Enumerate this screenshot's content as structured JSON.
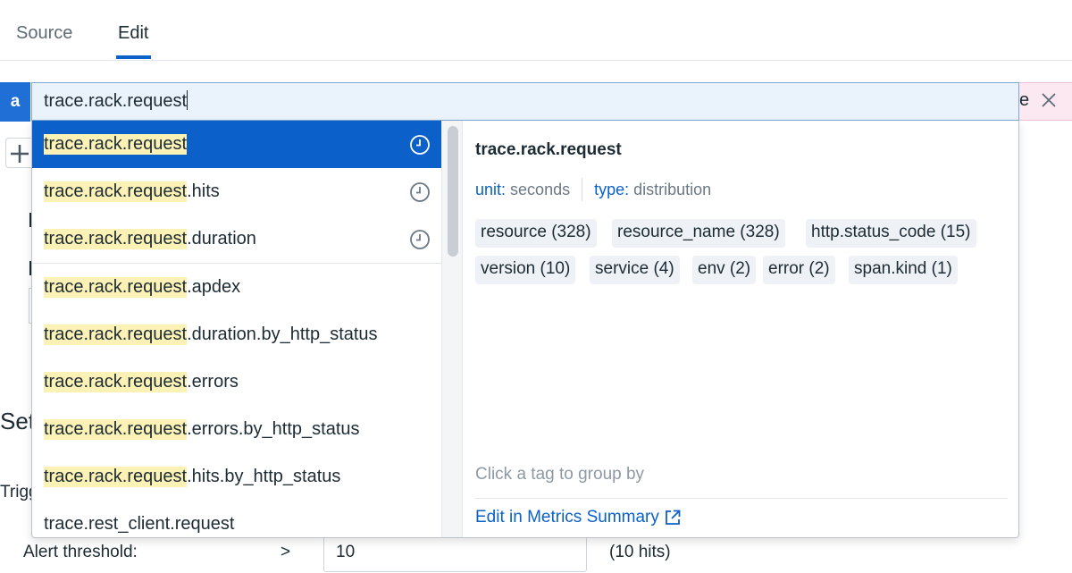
{
  "tabs": [
    {
      "label": "Source"
    },
    {
      "label": "Edit"
    }
  ],
  "query": {
    "letter": "a",
    "value": "trace.rack.request",
    "trailing_text": "e"
  },
  "suggestions": {
    "match": "trace.rack.request",
    "items": [
      {
        "match": "trace.rack.request",
        "suffix": "",
        "recent": true,
        "selected": true
      },
      {
        "match": "trace.rack.request",
        "suffix": ".hits",
        "recent": true
      },
      {
        "match": "trace.rack.request",
        "suffix": ".duration",
        "recent": true
      },
      {
        "match": "trace.rack.request",
        "suffix": ".apdex",
        "recent": false
      },
      {
        "match": "trace.rack.request",
        "suffix": ".duration.by_http_status",
        "recent": false
      },
      {
        "match": "trace.rack.request",
        "suffix": ".errors",
        "recent": false
      },
      {
        "match": "trace.rack.request",
        "suffix": ".errors.by_http_status",
        "recent": false
      },
      {
        "match": "trace.rack.request",
        "suffix": ".hits.by_http_status",
        "recent": false
      },
      {
        "match": "",
        "suffix": "trace.rest_client.request",
        "recent": false
      }
    ]
  },
  "detail": {
    "title": "trace.rack.request",
    "unit_key": "unit:",
    "unit_value": "seconds",
    "type_key": "type:",
    "type_value": "distribution",
    "tags": [
      "resource (328)",
      "resource_name (328)",
      "http.status_code (15)",
      "version (10)",
      "service (4)",
      "env (2)",
      "error (2)",
      "span.kind (1)"
    ],
    "hint": "Click a tag to group by",
    "link": "Edit in Metrics Summary"
  },
  "background": {
    "set_text": "Set",
    "trigger_text": "Trigg",
    "alert_label": "Alert threshold:",
    "alert_operator": ">",
    "alert_value": "10",
    "alert_hint": "(10 hits)"
  },
  "colors": {
    "accent": "#0b61c9",
    "highlight": "#fdf2b5",
    "query_bg": "#eaf3fb"
  }
}
